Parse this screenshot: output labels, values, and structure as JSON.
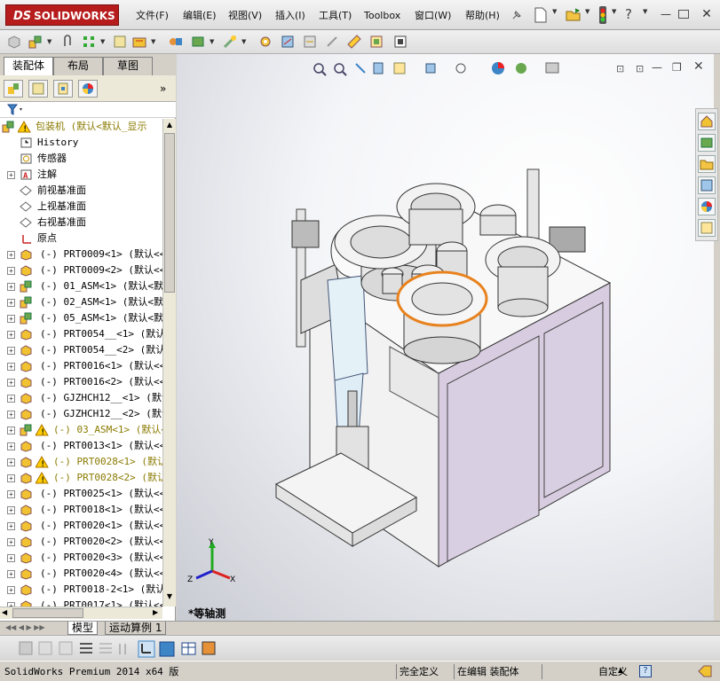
{
  "app": {
    "name": "SOLIDWORKS",
    "logo_prefix": "DS"
  },
  "menu": [
    "文件(F)",
    "编辑(E)",
    "视图(V)",
    "插入(I)",
    "工具(T)",
    "Toolbox",
    "窗口(W)",
    "帮助(H)"
  ],
  "tabs": [
    "装配体",
    "布局",
    "草图"
  ],
  "tree": {
    "root": "包装机  (默认<默认_显示",
    "items": [
      {
        "label": "History",
        "icon": "history-icon"
      },
      {
        "label": "传感器",
        "icon": "sensor-icon"
      },
      {
        "label": "注解",
        "icon": "annotation-icon"
      },
      {
        "label": "前视基准面",
        "icon": "plane-icon"
      },
      {
        "label": "上视基准面",
        "icon": "plane-icon"
      },
      {
        "label": "右视基准面",
        "icon": "plane-icon"
      },
      {
        "label": "原点",
        "icon": "origin-icon"
      },
      {
        "label": "(-) PRT0009<1> (默认<<默",
        "icon": "part-icon"
      },
      {
        "label": "(-) PRT0009<2> (默认<<默",
        "icon": "part-icon"
      },
      {
        "label": "(-) 01_ASM<1> (默认<默认",
        "icon": "assembly-icon"
      },
      {
        "label": "(-) 02_ASM<1> (默认<默认",
        "icon": "assembly-icon"
      },
      {
        "label": "(-) 05_ASM<1> (默认<默认",
        "icon": "assembly-icon"
      },
      {
        "label": "(-) PRT0054__<1> (默认<",
        "icon": "part-icon"
      },
      {
        "label": "(-) PRT0054__<2> (默认<",
        "icon": "part-icon"
      },
      {
        "label": "(-) PRT0016<1> (默认<<默",
        "icon": "part-icon"
      },
      {
        "label": "(-) PRT0016<2> (默认<<默",
        "icon": "part-icon"
      },
      {
        "label": "(-) GJZHCH12__<1> (默认",
        "icon": "part-icon"
      },
      {
        "label": "(-) GJZHCH12__<2> (默认",
        "icon": "part-icon"
      },
      {
        "label": "(-) 03_ASM<1> (默认<",
        "icon": "assembly-icon",
        "warn": true
      },
      {
        "label": "(-) PRT0013<1> (默认<<默",
        "icon": "part-icon"
      },
      {
        "label": "(-) PRT0028<1> (默认",
        "icon": "part-icon",
        "warn": true
      },
      {
        "label": "(-) PRT0028<2> (默认",
        "icon": "part-icon",
        "warn": true
      },
      {
        "label": "(-) PRT0025<1> (默认<<默",
        "icon": "part-icon"
      },
      {
        "label": "(-) PRT0018<1> (默认<<默",
        "icon": "part-icon"
      },
      {
        "label": "(-) PRT0020<1> (默认<<默",
        "icon": "part-icon"
      },
      {
        "label": "(-) PRT0020<2> (默认<<默",
        "icon": "part-icon"
      },
      {
        "label": "(-) PRT0020<3> (默认<<默",
        "icon": "part-icon"
      },
      {
        "label": "(-) PRT0020<4> (默认<<默",
        "icon": "part-icon"
      },
      {
        "label": "(-) PRT0018-2<1> (默认<",
        "icon": "part-icon"
      },
      {
        "label": "(-) PRT0017<1> (默认<<默",
        "icon": "part-icon"
      }
    ]
  },
  "bottom_tabs": [
    "模型",
    "运动算例 1"
  ],
  "viewport": {
    "view_label": "*等轴测",
    "triad": {
      "x": "X",
      "y": "Y",
      "z": "Z"
    }
  },
  "status": {
    "app": "SolidWorks Premium 2014 x64 版",
    "defined": "完全定义",
    "editing": "在编辑 装配体",
    "custom": "自定义"
  },
  "colors": {
    "logo_red": "#b71c1c",
    "machine_body": "#d8cde0",
    "highlight_orange": "#e8821e"
  }
}
